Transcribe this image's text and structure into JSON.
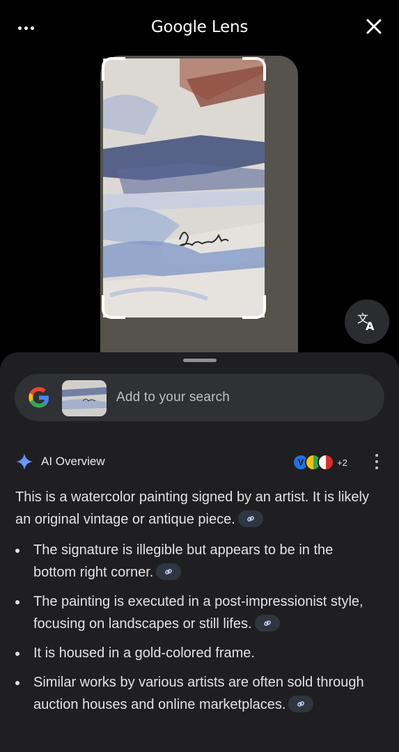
{
  "header": {
    "title": "Google Lens",
    "more_icon": "more-horizontal-icon",
    "close_icon": "close-icon"
  },
  "preview": {
    "translate_icon": "translate-icon"
  },
  "search": {
    "placeholder": "Add to your search"
  },
  "ai_overview": {
    "title": "AI Overview",
    "sources_extra": "+2",
    "intro": "This is a watercolor painting signed by an artist. It is likely an original vintage or antique piece.",
    "bullets": [
      "The signature is illegible but appears to be in the bottom right corner.",
      "The painting is executed in a post-impressionist style, focusing on landscapes or still lifes.",
      "It is housed in a gold-colored frame.",
      "Similar works by various artists are often sold through auction houses and online marketplaces."
    ]
  },
  "colors": {
    "sheet_bg": "#1f1f21",
    "search_bg": "#303134",
    "link_chip_bg": "#303542",
    "accent_blue": "#4285f4"
  }
}
